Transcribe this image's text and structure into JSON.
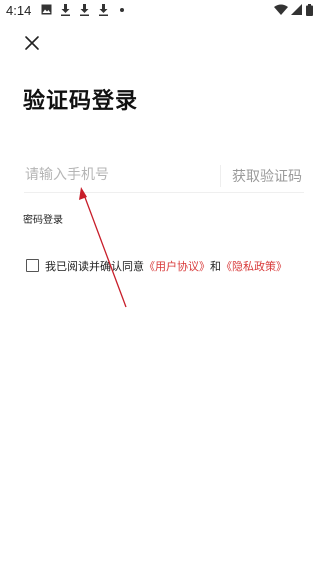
{
  "status_bar": {
    "time": "4:14",
    "left_icons": [
      "image-icon",
      "download-icon",
      "download-icon",
      "download-icon",
      "dot-icon"
    ],
    "right_icons": [
      "wifi-icon",
      "signal-icon",
      "battery-icon"
    ]
  },
  "header": {
    "close_icon": "close-icon"
  },
  "login": {
    "title": "验证码登录",
    "phone_placeholder": "请输入手机号",
    "phone_value": "",
    "get_code_label": "获取验证码",
    "password_login_label": "密码登录"
  },
  "agreement": {
    "checked": false,
    "prefix": "我已阅读并确认同意",
    "user_agreement": "《用户协议》",
    "conjunction": "和",
    "privacy_policy": "《隐私政策》"
  },
  "colors": {
    "link": "#d83a3a",
    "annotation": "#c81e2a",
    "placeholder": "#b5b5b5",
    "muted_button": "#9a9a9a"
  }
}
